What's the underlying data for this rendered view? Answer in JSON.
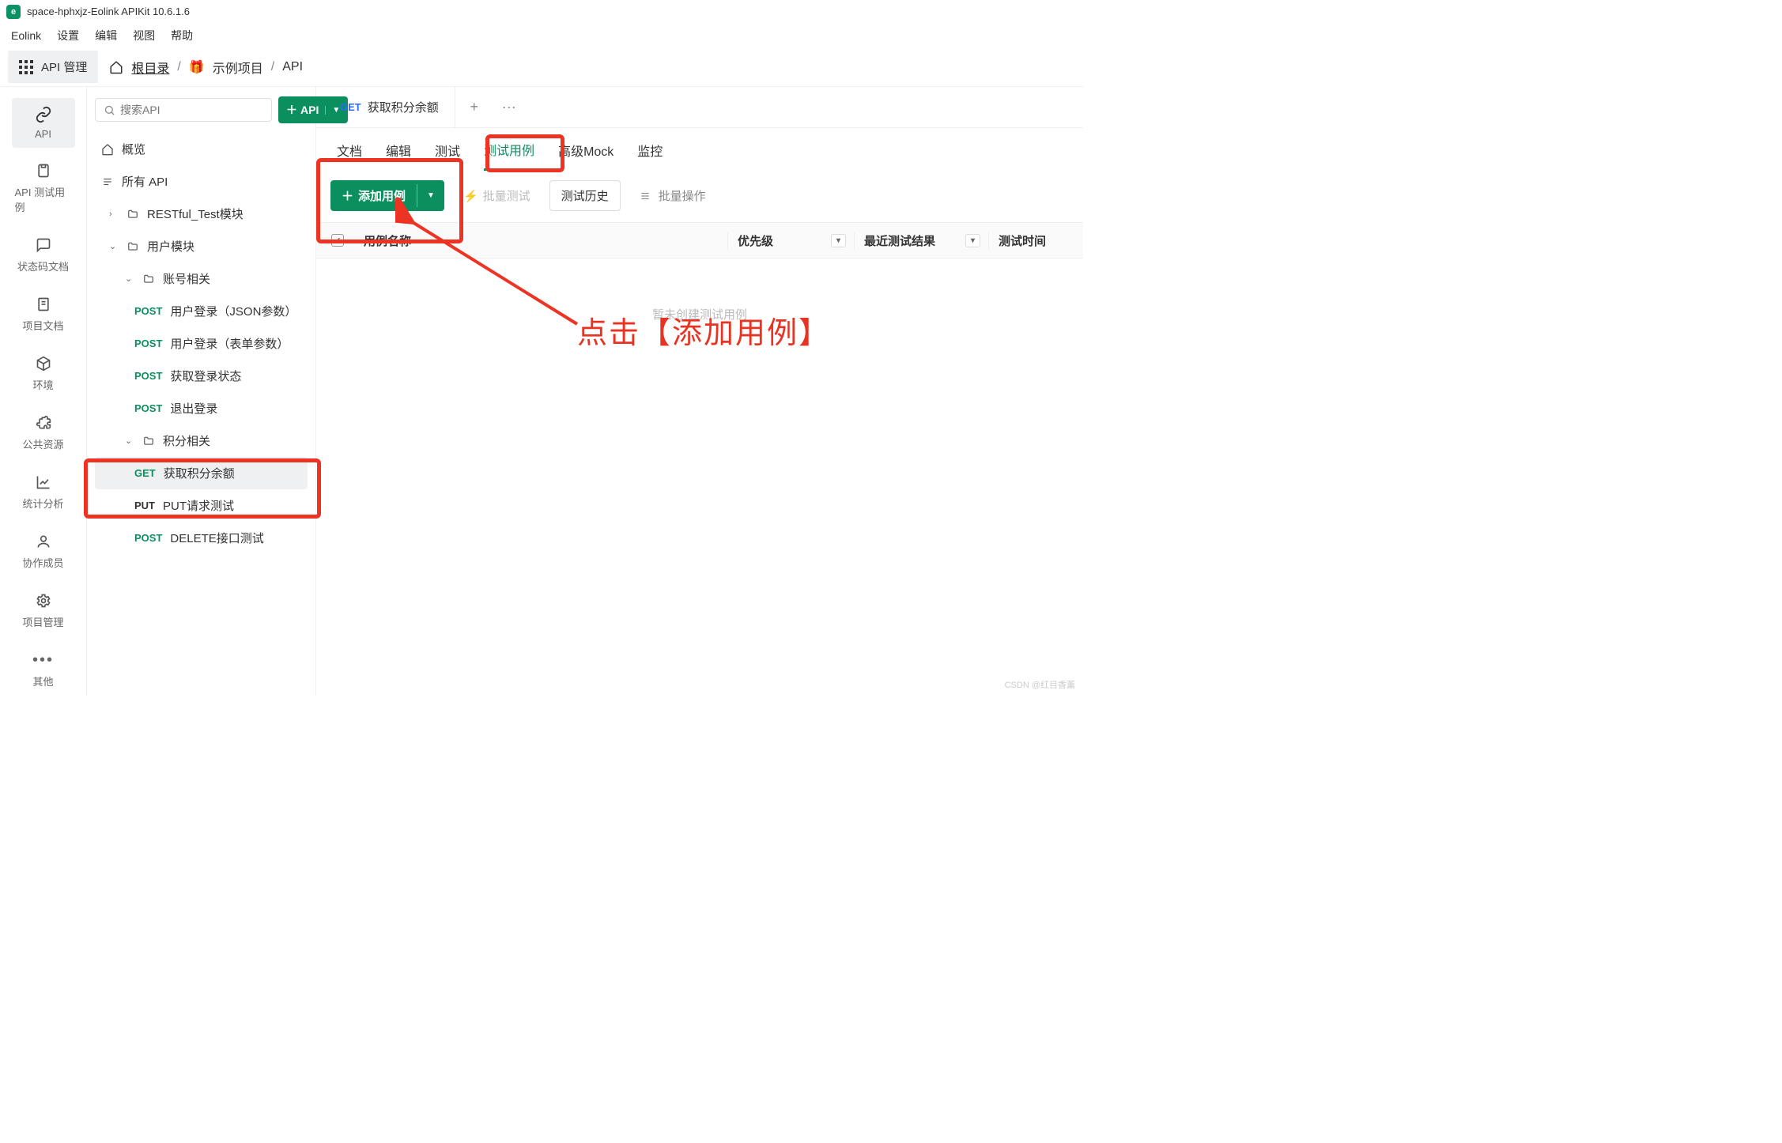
{
  "window": {
    "title": "space-hphxjz-Eolink APIKit 10.6.1.6"
  },
  "menubar": [
    "Eolink",
    "设置",
    "编辑",
    "视图",
    "帮助"
  ],
  "topbar": {
    "api_mgmt": "API 管理",
    "breadcrumb": {
      "root": "根目录",
      "project": "示例项目",
      "leaf": "API"
    }
  },
  "leftnav": [
    {
      "id": "api",
      "label": "API",
      "icon": "link-icon"
    },
    {
      "id": "testcase",
      "label": "API 测试用例",
      "icon": "clipboard-icon"
    },
    {
      "id": "status",
      "label": "状态码文档",
      "icon": "message-icon"
    },
    {
      "id": "docs",
      "label": "项目文档",
      "icon": "doc-icon"
    },
    {
      "id": "env",
      "label": "环境",
      "icon": "box-icon"
    },
    {
      "id": "public",
      "label": "公共资源",
      "icon": "puzzle-icon"
    },
    {
      "id": "stats",
      "label": "统计分析",
      "icon": "chart-icon"
    },
    {
      "id": "team",
      "label": "协作成员",
      "icon": "user-icon"
    },
    {
      "id": "mgmt",
      "label": "项目管理",
      "icon": "gear-icon"
    },
    {
      "id": "other",
      "label": "其他",
      "icon": "more-icon"
    }
  ],
  "sidebar": {
    "search_placeholder": "搜索API",
    "add_api": "API",
    "overview": "概览",
    "all_api": "所有 API",
    "tree": [
      {
        "type": "folder",
        "label": "RESTful_Test模块",
        "expanded": false,
        "indent": 1
      },
      {
        "type": "folder",
        "label": "用户模块",
        "expanded": true,
        "indent": 1
      },
      {
        "type": "folder",
        "label": "账号相关",
        "expanded": true,
        "indent": 2
      },
      {
        "type": "api",
        "method": "POST",
        "label": "用户登录（JSON参数）",
        "indent": 3
      },
      {
        "type": "api",
        "method": "POST",
        "label": "用户登录（表单参数）",
        "indent": 3
      },
      {
        "type": "api",
        "method": "POST",
        "label": "获取登录状态",
        "indent": 3
      },
      {
        "type": "api",
        "method": "POST",
        "label": "退出登录",
        "indent": 3
      },
      {
        "type": "folder",
        "label": "积分相关",
        "expanded": true,
        "indent": 2
      },
      {
        "type": "api",
        "method": "GET",
        "label": "获取积分余额",
        "indent": 3,
        "selected": true
      },
      {
        "type": "api",
        "method": "PUT",
        "label": "PUT请求测试",
        "indent": 3
      },
      {
        "type": "api",
        "method": "POST",
        "label": "DELETE接口测试",
        "indent": 3
      }
    ]
  },
  "main": {
    "tab": {
      "method": "GET",
      "label": "获取积分余额"
    },
    "subtabs": [
      "文档",
      "编辑",
      "测试",
      "测试用例",
      "高级Mock",
      "监控"
    ],
    "active_subtab": "测试用例",
    "toolbar": {
      "add_case": "添加用例",
      "batch_test": "批量测试",
      "test_history": "测试历史",
      "batch_ops": "批量操作"
    },
    "table": {
      "headers": {
        "name": "用例名称",
        "priority": "优先级",
        "last_result": "最近测试结果",
        "time": "测试时间"
      },
      "empty": "暂未创建测试用例"
    }
  },
  "annotation": "点击【添加用例】",
  "watermark": "CSDN @红目香薰"
}
